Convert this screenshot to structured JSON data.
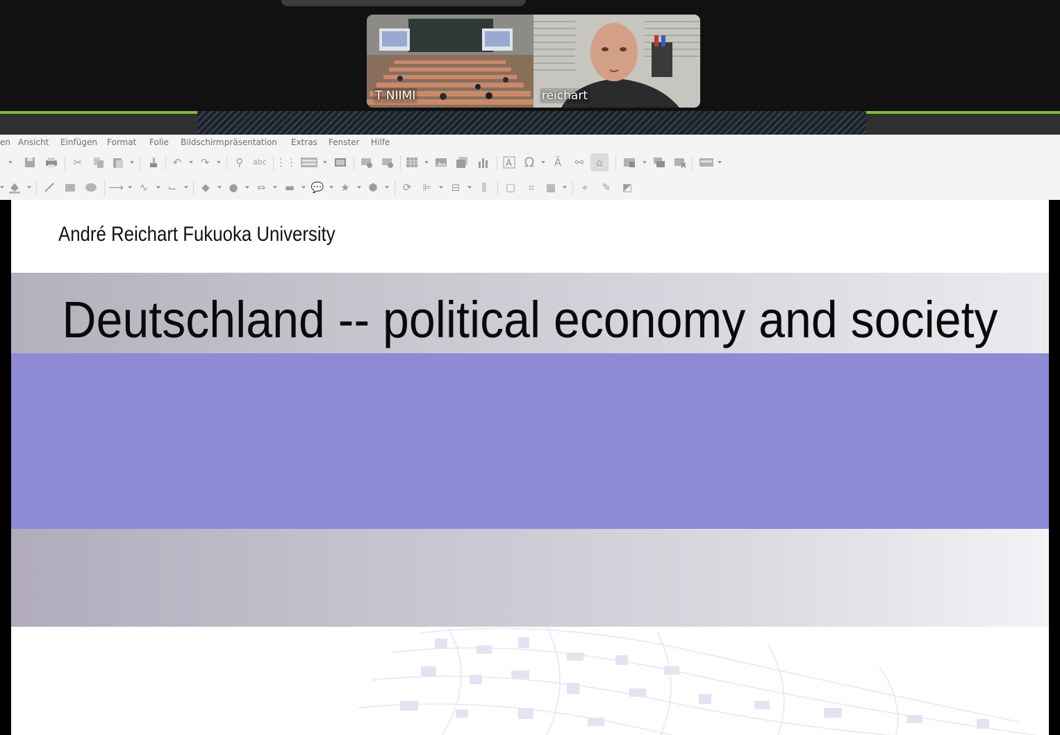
{
  "zoom": {
    "participants": [
      {
        "name": "T NIIMI"
      },
      {
        "name": "reichart"
      }
    ],
    "accent_color": "#7bbf3a"
  },
  "menubar": {
    "items": [
      "en",
      "Ansicht",
      "Einfügen",
      "Format",
      "Folie",
      "Bildschirmpräsentation",
      "Extras",
      "Fenster",
      "Hilfe"
    ]
  },
  "toolbar1": {
    "icons": [
      "dropdown",
      "save-icon",
      "print-icon",
      "cut-icon",
      "copy-icon",
      "paste-icon",
      "clone-formatting-icon",
      "undo-icon",
      "redo-icon",
      "find-replace-icon",
      "spellcheck-icon",
      "grid-icon",
      "display-views-icon",
      "master-slide-icon",
      "start-from-first-icon",
      "start-from-current-icon",
      "table-icon",
      "image-icon",
      "media-icon",
      "chart-icon",
      "text-box-icon",
      "special-character-icon",
      "fontwork-icon",
      "hyperlink-icon",
      "basic-shapes-icon",
      "show-draw-functions-icon",
      "slide-layout-icon",
      "duplicate-slide-icon",
      "delete-slide-icon",
      "display-mode-icon"
    ]
  },
  "toolbar2": {
    "icons": [
      "fill-color-icon",
      "line-icon",
      "rectangle-icon",
      "ellipse-icon",
      "arrow-line-icon",
      "curve-icon",
      "connector-icon",
      "diamond-icon",
      "circle-shape-icon",
      "double-arrow-icon",
      "flowchart-icon",
      "callout-icon",
      "star-icon",
      "3d-object-icon",
      "rotate-icon",
      "align-icon",
      "arrange-icon",
      "distribute-icon",
      "shadow-icon",
      "crop-icon",
      "filter-icon",
      "points-icon",
      "glue-points-icon",
      "toggle-extrusion-icon"
    ]
  },
  "slide": {
    "author": "André Reichart Fukuoka University",
    "title": "Deutschland -- political economy and society",
    "band_colors": {
      "purple": "#8f8ad6",
      "grey": "#c6c2cf"
    }
  }
}
